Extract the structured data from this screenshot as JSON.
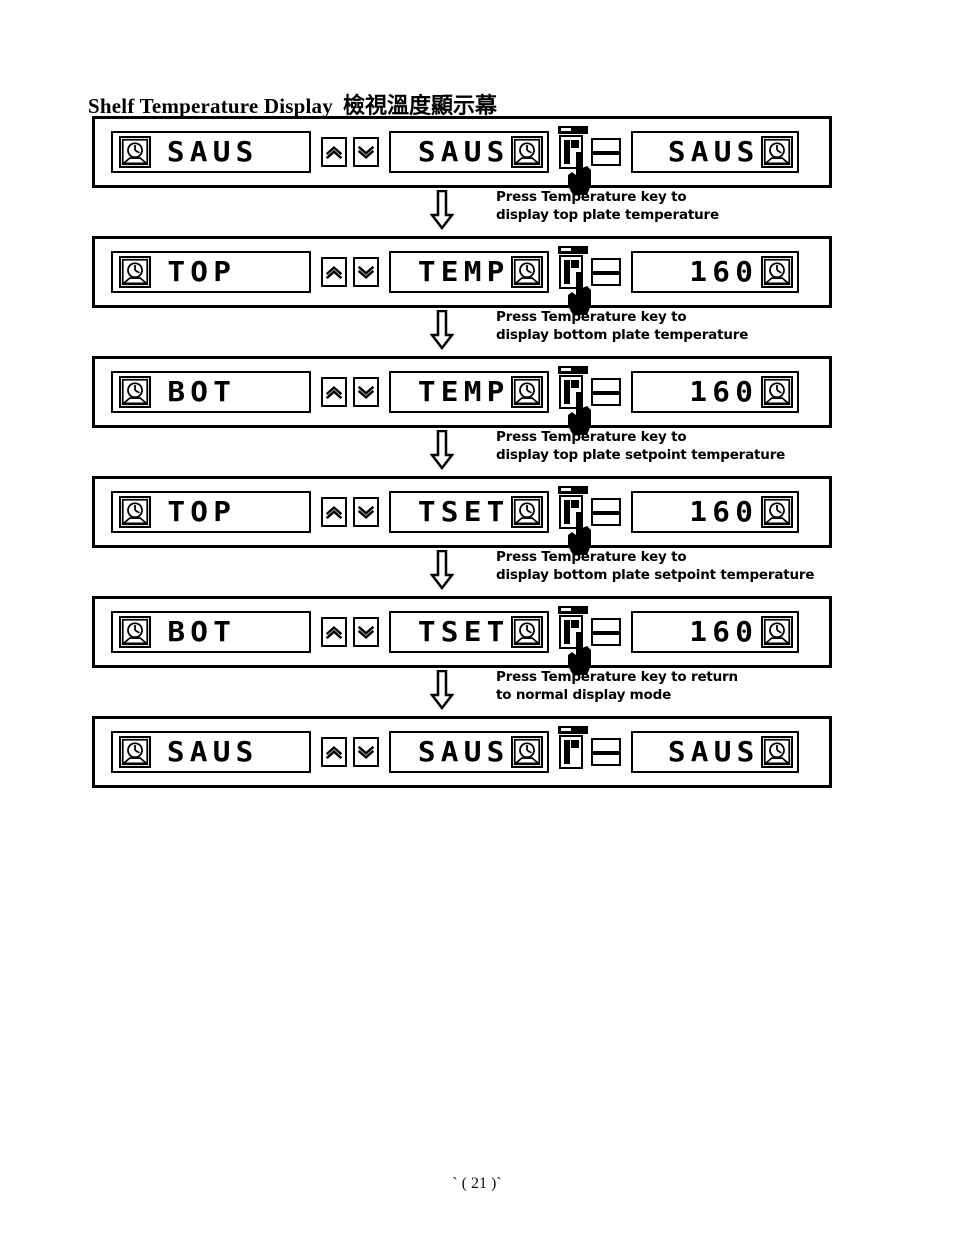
{
  "document": {
    "title_en": "Shelf Temperature Display",
    "title_zh": "檢視溫度顯示幕",
    "page_number": "`  ( 21 )`"
  },
  "icons": {
    "clock": "clock-icon",
    "chevron_up": "chevron-up-icon",
    "chevron_down": "chevron-down-icon",
    "temperature_key": "temperature-key-icon",
    "bar_key": "bar-key-icon",
    "pressing_hand": "pressing-hand-icon",
    "flow_arrow": "down-arrow-icon"
  },
  "colors": {
    "ink": "#000000",
    "paper": "#ffffff"
  },
  "steps": [
    {
      "panel": {
        "name": "controller-panel-1",
        "left_display": "SAUS",
        "middle_display": "SAUS",
        "right_display": "SAUS",
        "hand_pressing": true
      },
      "instruction_line1": "Press Temperature key to",
      "instruction_line2": "display top plate temperature"
    },
    {
      "panel": {
        "name": "controller-panel-2",
        "left_display": "TOP",
        "middle_display": "TEMP",
        "right_display": "160",
        "hand_pressing": true
      },
      "instruction_line1": "Press Temperature key to",
      "instruction_line2": "display bottom plate temperature"
    },
    {
      "panel": {
        "name": "controller-panel-3",
        "left_display": "BOT",
        "middle_display": "TEMP",
        "right_display": "160",
        "hand_pressing": true
      },
      "instruction_line1": "Press Temperature key to",
      "instruction_line2": "display top plate setpoint temperature"
    },
    {
      "panel": {
        "name": "controller-panel-4",
        "left_display": "TOP",
        "middle_display": "TSET",
        "right_display": "160",
        "hand_pressing": true
      },
      "instruction_line1": "Press Temperature key to",
      "instruction_line2": "display bottom plate setpoint temperature"
    },
    {
      "panel": {
        "name": "controller-panel-5",
        "left_display": "BOT",
        "middle_display": "TSET",
        "right_display": "160",
        "hand_pressing": true
      },
      "instruction_line1": "Press Temperature key to return",
      "instruction_line2": "to normal display mode"
    },
    {
      "panel": {
        "name": "controller-panel-6",
        "left_display": "SAUS",
        "middle_display": "SAUS",
        "right_display": "SAUS",
        "hand_pressing": false
      },
      "instruction_line1": "",
      "instruction_line2": ""
    }
  ]
}
